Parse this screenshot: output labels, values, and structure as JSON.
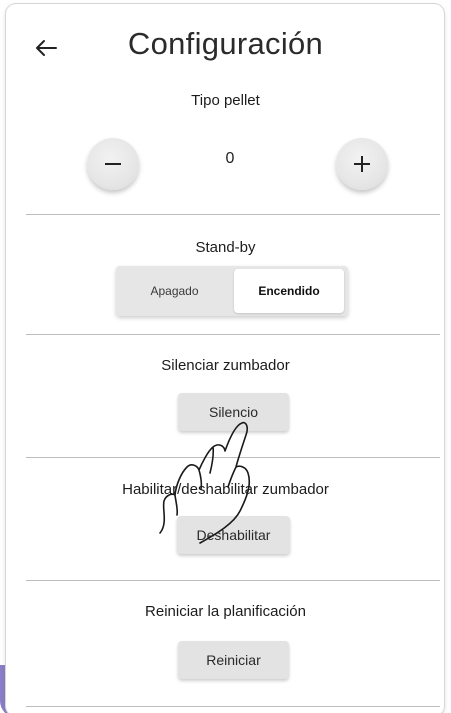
{
  "header": {
    "title": "Configuración",
    "back_icon": "arrow-left-icon"
  },
  "pellet": {
    "label": "Tipo pellet",
    "value": "0",
    "decrement_icon": "minus-icon",
    "increment_icon": "plus-icon"
  },
  "standby": {
    "label": "Stand-by",
    "options": [
      "Apagado",
      "Encendido"
    ],
    "selected": "Encendido"
  },
  "mute": {
    "label": "Silenciar zumbador",
    "button": "Silencio"
  },
  "buzzer": {
    "label": "Habilitar/deshabilitar zumbador",
    "button": "Deshabilitar"
  },
  "schedule": {
    "label": "Reiniciar la planificación",
    "button": "Reiniciar"
  },
  "colors": {
    "background": "#ffffff",
    "button": "#e3e3e3",
    "divider": "#bdbdbd",
    "accent_corner": "#8a7fc8"
  },
  "overlay": {
    "icon": "hand-pointer-icon"
  }
}
